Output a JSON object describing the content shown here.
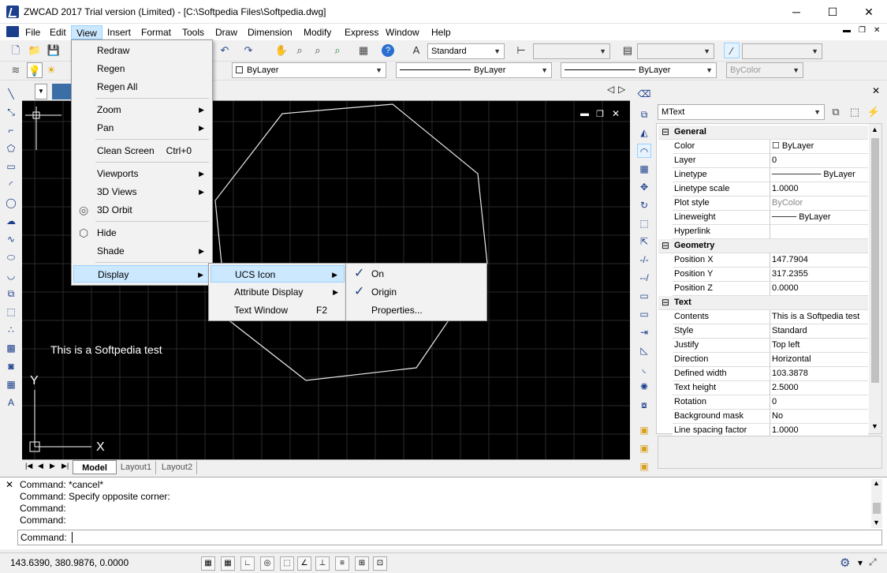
{
  "window": {
    "title": "ZWCAD 2017 Trial version (Limited) - [C:\\Softpedia Files\\Softpedia.dwg]",
    "minimize": "─",
    "maximize": "☐",
    "close": "✕"
  },
  "menubar": [
    "File",
    "Edit",
    "View",
    "Insert",
    "Format",
    "Tools",
    "Draw",
    "Dimension",
    "Modify",
    "Express",
    "Window",
    "Help"
  ],
  "mdi_controls": {
    "minimize": "▬",
    "restore": "❐",
    "close": "✕"
  },
  "toolbar": {
    "text_style": "Standard",
    "layer_color": "ByLayer",
    "linetype": "ByLayer",
    "lineweight": "ByLayer",
    "plot_style": "ByColor"
  },
  "view_menu": {
    "items": [
      {
        "label": "Redraw",
        "shortcut": "",
        "submenu": false
      },
      {
        "label": "Regen",
        "shortcut": "",
        "submenu": false
      },
      {
        "label": "Regen All",
        "shortcut": "",
        "submenu": false
      },
      {
        "label": "Zoom",
        "shortcut": "",
        "submenu": true
      },
      {
        "label": "Pan",
        "shortcut": "",
        "submenu": true
      },
      {
        "label": "Clean Screen",
        "shortcut": "Ctrl+0",
        "submenu": false
      },
      {
        "label": "Viewports",
        "shortcut": "",
        "submenu": true
      },
      {
        "label": "3D Views",
        "shortcut": "",
        "submenu": true
      },
      {
        "label": "3D Orbit",
        "shortcut": "",
        "submenu": false
      },
      {
        "label": "Hide",
        "shortcut": "",
        "submenu": false
      },
      {
        "label": "Shade",
        "shortcut": "",
        "submenu": true
      },
      {
        "label": "Display",
        "shortcut": "",
        "submenu": true
      }
    ]
  },
  "display_menu": {
    "items": [
      {
        "label": "UCS Icon",
        "shortcut": "",
        "submenu": true
      },
      {
        "label": "Attribute Display",
        "shortcut": "",
        "submenu": true
      },
      {
        "label": "Text Window",
        "shortcut": "F2",
        "submenu": false
      }
    ]
  },
  "ucs_menu": {
    "items": [
      {
        "label": "On",
        "checked": true
      },
      {
        "label": "Origin",
        "checked": true
      },
      {
        "label": "Properties...",
        "checked": false
      }
    ]
  },
  "canvas": {
    "text": "This is a Softpedia test",
    "axis_x": "X",
    "axis_y": "Y"
  },
  "layout_tabs": [
    "Model",
    "Layout1",
    "Layout2"
  ],
  "command_history": [
    "Command: *cancel*",
    "Command: Specify opposite corner:",
    "Command:",
    "Command:"
  ],
  "command_prompt": "Command:",
  "status": {
    "coords": "143.6390, 380.9876, 0.0000"
  },
  "properties": {
    "object_type": "MText",
    "groups": [
      {
        "name": "General",
        "rows": [
          {
            "name": "Color",
            "value": "☐ ByLayer"
          },
          {
            "name": "Layer",
            "value": "0"
          },
          {
            "name": "Linetype",
            "value": "──────── ByLayer"
          },
          {
            "name": "Linetype scale",
            "value": "1.0000"
          },
          {
            "name": "Plot style",
            "value": "ByColor",
            "disabled": true
          },
          {
            "name": "Lineweight",
            "value": "──── ByLayer"
          },
          {
            "name": "Hyperlink",
            "value": ""
          }
        ]
      },
      {
        "name": "Geometry",
        "rows": [
          {
            "name": "Position X",
            "value": "147.7904"
          },
          {
            "name": "Position Y",
            "value": "317.2355"
          },
          {
            "name": "Position Z",
            "value": "0.0000"
          }
        ]
      },
      {
        "name": "Text",
        "rows": [
          {
            "name": "Contents",
            "value": "This is a Softpedia test"
          },
          {
            "name": "Style",
            "value": "Standard"
          },
          {
            "name": "Justify",
            "value": "Top left"
          },
          {
            "name": "Direction",
            "value": "Horizontal"
          },
          {
            "name": "Defined width",
            "value": "103.3878"
          },
          {
            "name": "Text height",
            "value": "2.5000"
          },
          {
            "name": "Rotation",
            "value": "0"
          },
          {
            "name": "Background mask",
            "value": "No"
          },
          {
            "name": "Line spacing factor",
            "value": "1.0000"
          }
        ]
      }
    ]
  }
}
